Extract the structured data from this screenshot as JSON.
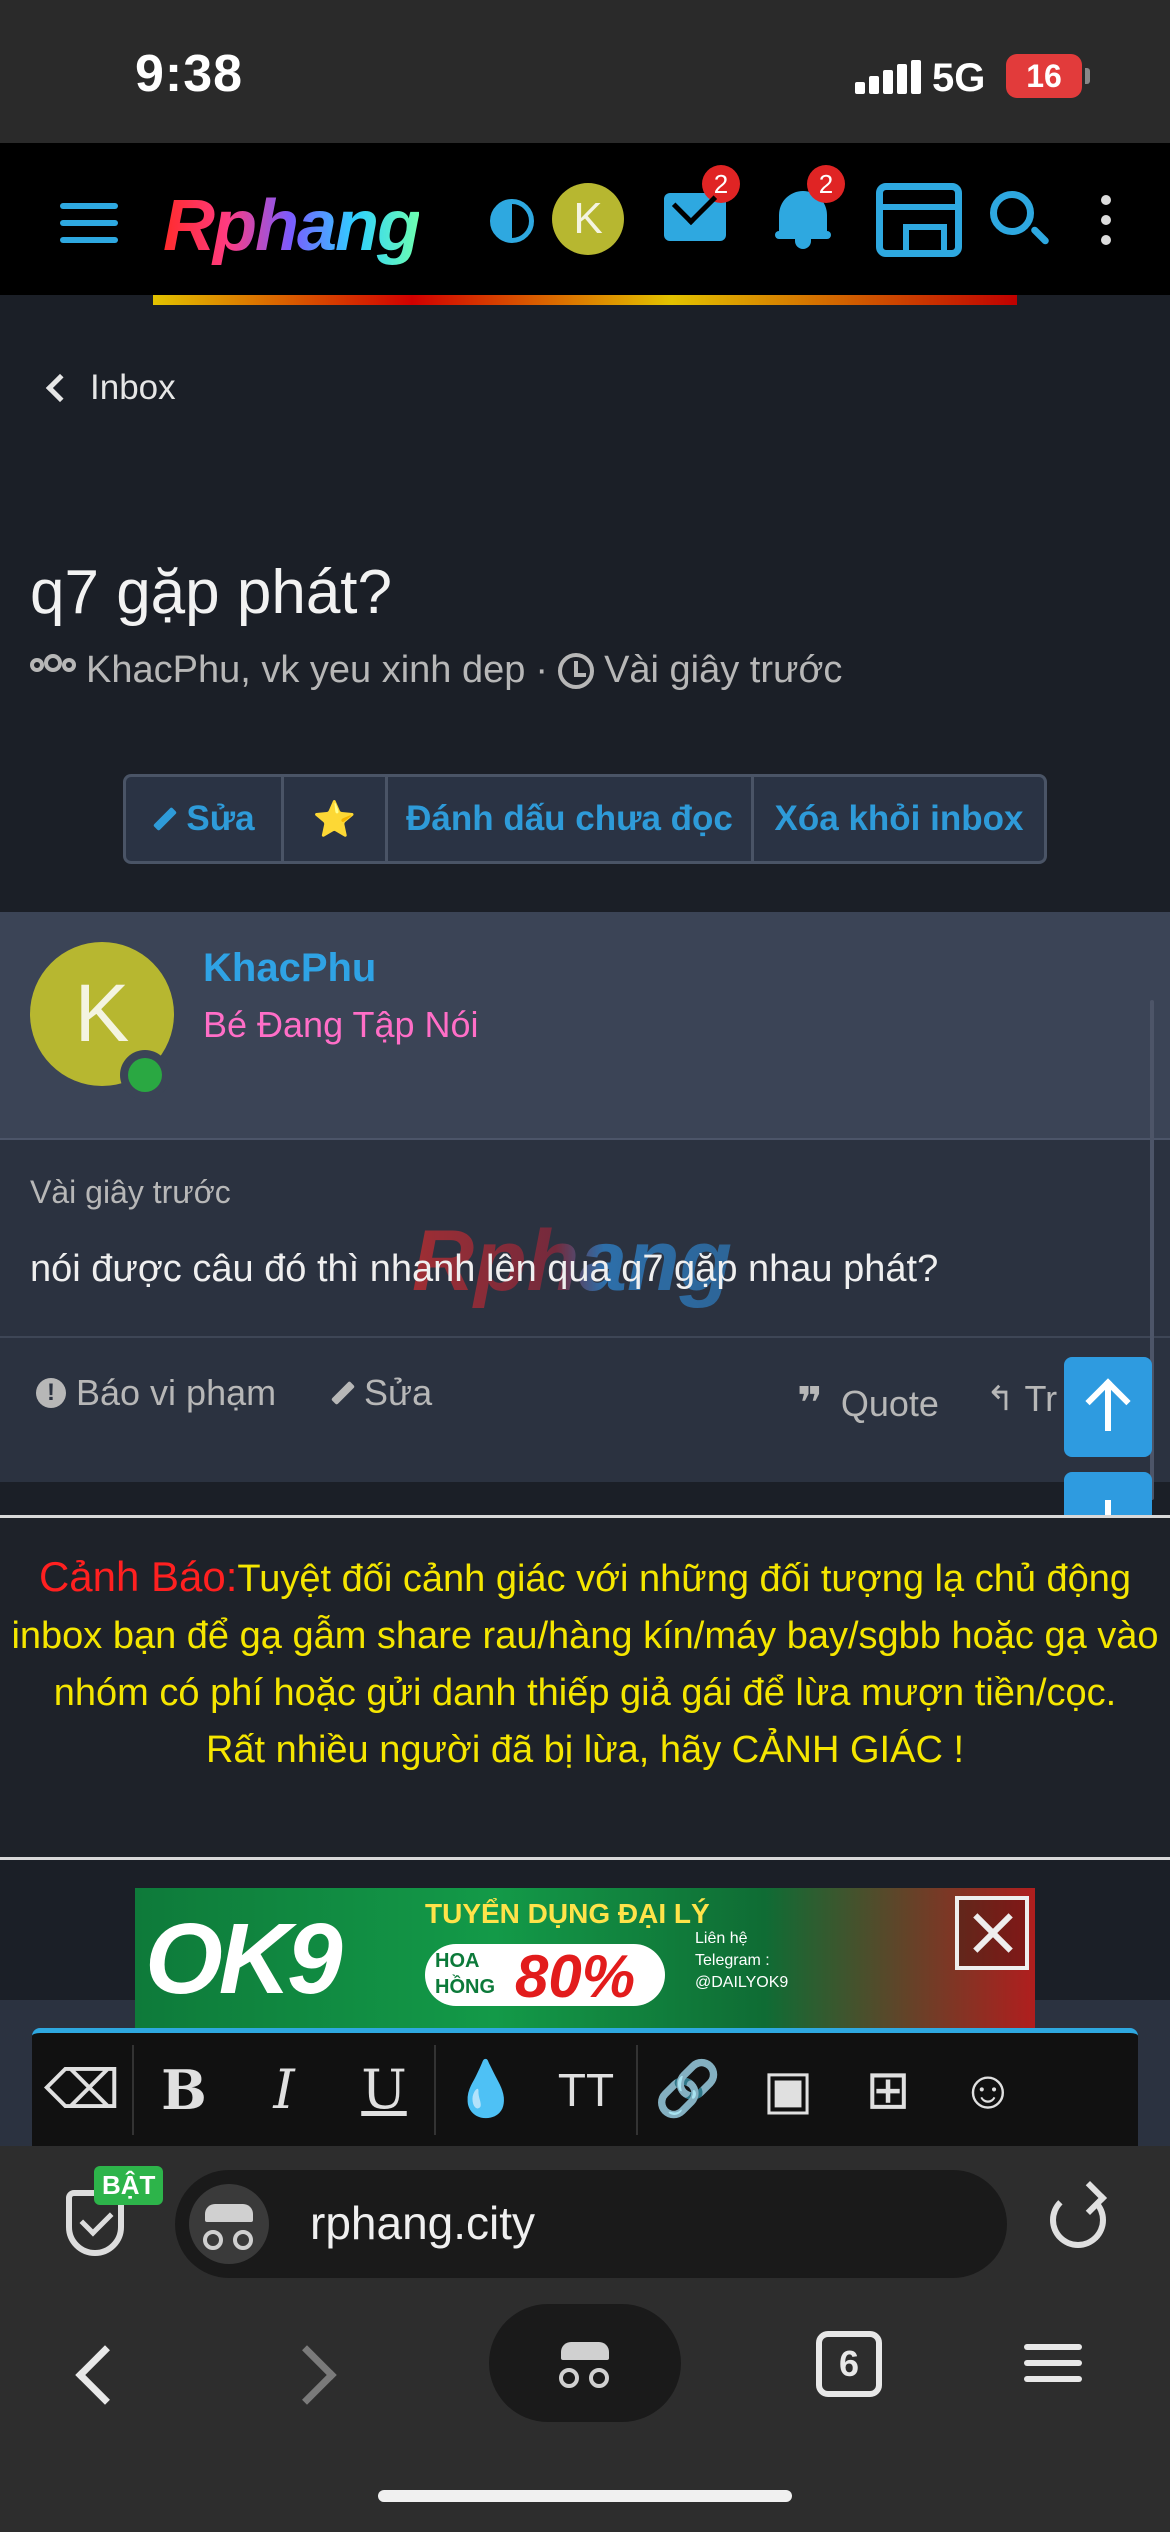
{
  "status_bar": {
    "time": "9:38",
    "network": "5G",
    "battery": "16"
  },
  "header": {
    "logo_text": "Rphang",
    "avatar_letter": "K",
    "mail_badge": "2",
    "notif_badge": "2",
    "accent_color": "#2ea8e0"
  },
  "nav": {
    "back_label": "Inbox"
  },
  "thread": {
    "title": "q7 gặp phát?",
    "participants": "KhacPhu, vk yeu xinh dep",
    "separator": "·",
    "time": "Vài giây trước",
    "actions": {
      "edit": "Sửa",
      "star": "⭐",
      "mark_unread": "Đánh dấu chưa đọc",
      "remove": "Xóa khỏi inbox"
    }
  },
  "message": {
    "avatar_letter": "K",
    "username": "KhacPhu",
    "user_title": "Bé Đang Tập Nói",
    "time": "Vài giây trước",
    "text": "nói được câu đó thì nhanh lên qua q7 gặp nhau phát?",
    "watermark": "Rphang",
    "actions": {
      "report": "Báo vi phạm",
      "edit": "Sửa",
      "quote": "Quote",
      "reply": "Tr"
    }
  },
  "warning": {
    "label": "Cảnh Báo:",
    "text": "Tuyệt đối cảnh giác với những đối tượng lạ chủ động inbox bạn để gạ gẫm share rau/hàng kín/máy bay/sgbb hoặc gạ vào nhóm có phí hoặc gửi danh thiếp giả gái để lừa mượn tiền/cọc.",
    "emphasis": "Rất nhiều người đã bị lừa, hãy CẢNH GIÁC !"
  },
  "ad": {
    "logo": "OK9",
    "headline": "TUYỂN DỤNG ĐẠI LÝ",
    "hoa_hong": "HOA HỒNG",
    "percent": "80%",
    "contact": "Liên hệ Telegram : @DAILYOK9"
  },
  "editor_toolbar": {
    "tools": [
      "eraser-icon",
      "bold-icon",
      "italic-icon",
      "underline-icon",
      "color-icon",
      "text-size-icon",
      "link-icon",
      "image-icon",
      "video-icon",
      "emoji-icon"
    ],
    "bold": "B",
    "italic": "I",
    "underline": "U",
    "textsize": "TT"
  },
  "browser": {
    "shield_badge": "BẬT",
    "url": "rphang.city",
    "tab_count": "6"
  }
}
